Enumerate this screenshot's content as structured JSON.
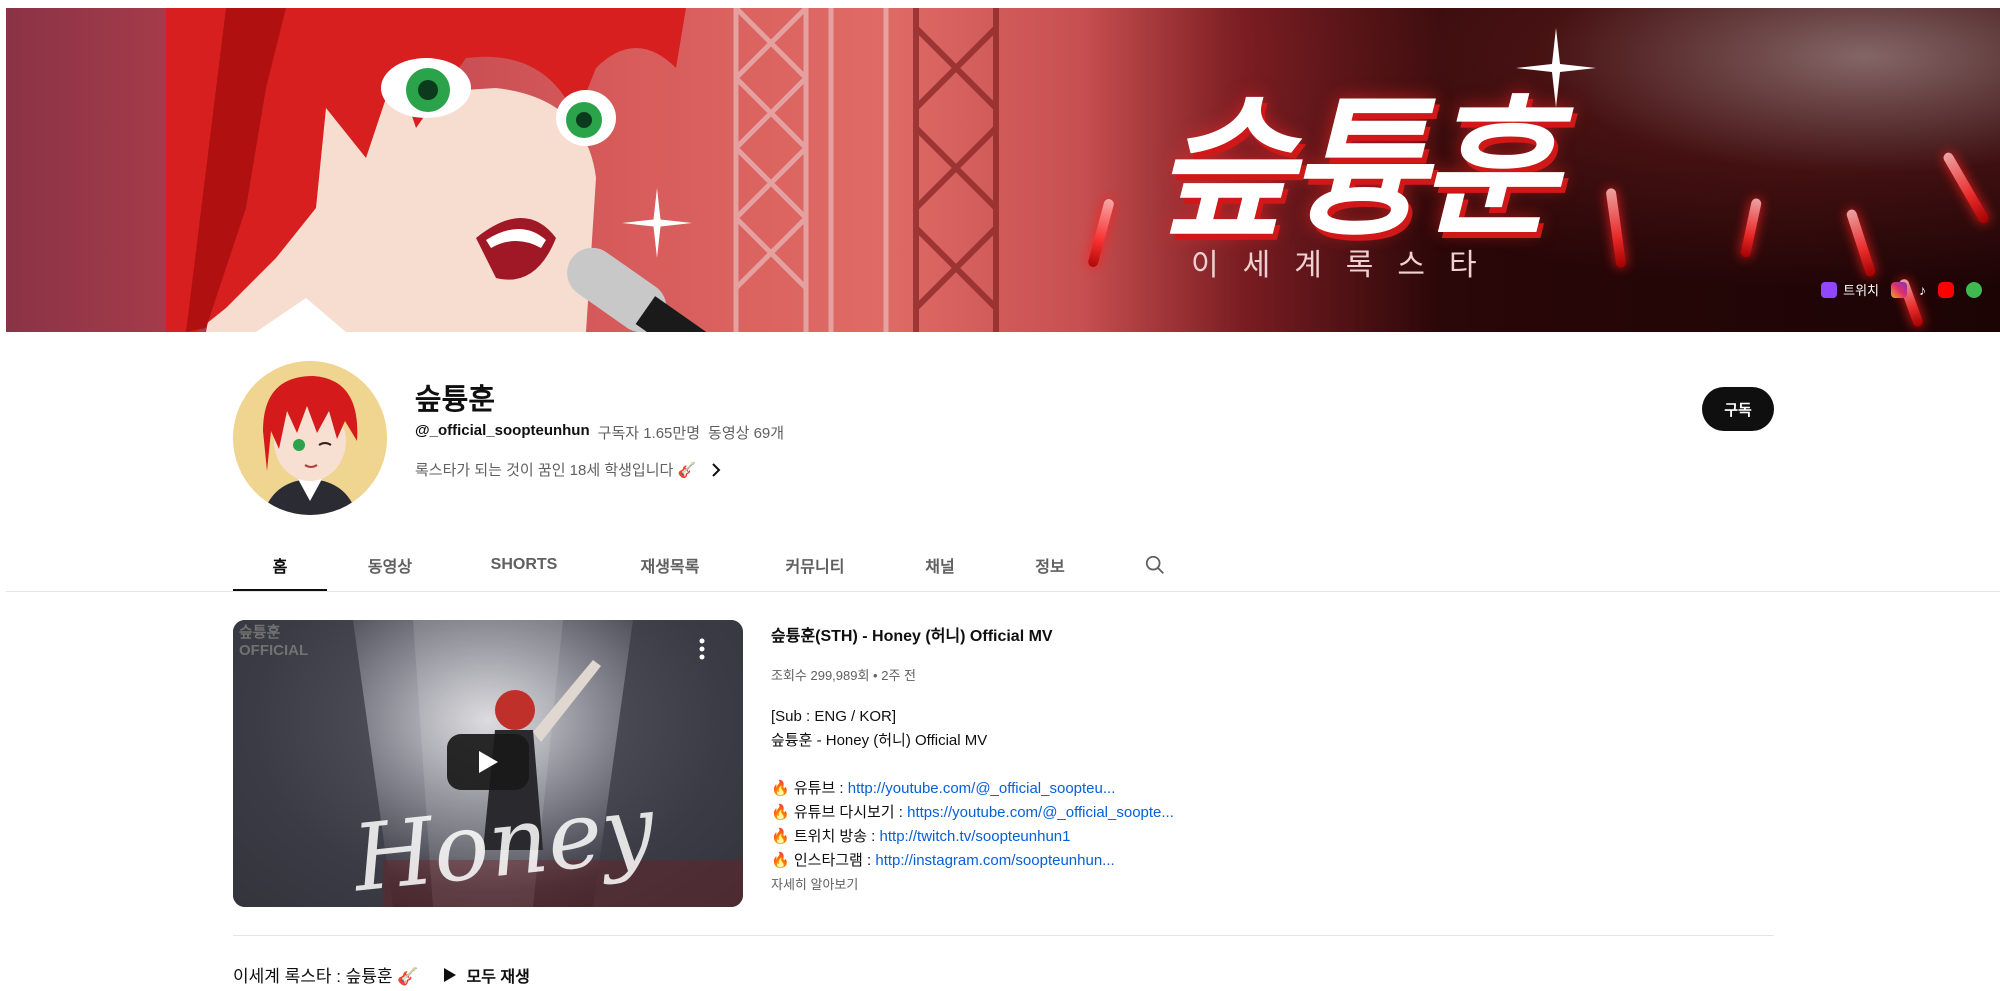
{
  "banner": {
    "logo_title": "슾튱훈",
    "logo_subtitle": "이세계록스타",
    "links": [
      {
        "icon": "twitch-icon",
        "label": "트위치",
        "color": "#9146ff"
      },
      {
        "icon": "instagram-icon",
        "label": "",
        "color": "#e1306c"
      },
      {
        "icon": "tiktok-icon",
        "label": "",
        "color": "#000000"
      },
      {
        "icon": "youtube-icon",
        "label": "",
        "color": "#ff0000"
      },
      {
        "icon": "apple-icon",
        "label": "",
        "color": "#3fb950"
      }
    ]
  },
  "channel": {
    "name": "슾튱훈",
    "handle": "@_official_soopteunhun",
    "subscribers": "구독자 1.65만명",
    "videos": "동영상 69개",
    "description": "록스타가 되는 것이 꿈인 18세 학생입니다 🎸",
    "subscribe_label": "구독"
  },
  "tabs": [
    "홈",
    "동영상",
    "SHORTS",
    "재생목록",
    "커뮤니티",
    "채널",
    "정보"
  ],
  "active_tab": 0,
  "featured": {
    "watermark": "슾튱훈\nOFFICIAL",
    "title": "슾튱훈(STH) - Honey (허니) Official MV",
    "stats": "조회수 299,989회 • 2주 전",
    "thumbnail_text": "Honey",
    "desc_lines": [
      {
        "text": "[Sub : ENG / KOR]",
        "link": ""
      },
      {
        "text": "슾튱훈 - Honey (허니) Official MV",
        "link": ""
      },
      {
        "text": "",
        "link": ""
      },
      {
        "text": "🔥 유튜브 : ",
        "link": "http://youtube.com/@_official_soopteu..."
      },
      {
        "text": "🔥 유튜브 다시보기 : ",
        "link": "https://youtube.com/@_official_soopte..."
      },
      {
        "text": "🔥 트위치 방송 : ",
        "link": "http://twitch.tv/soopteunhun1"
      },
      {
        "text": "🔥 인스타그램 : ",
        "link": "http://instagram.com/soopteunhun..."
      }
    ],
    "more_label": "자세히 알아보기"
  },
  "shelf": {
    "title": "이세계 록스타 : 슾튱훈 🎸",
    "play_all": "모두 재생"
  },
  "colors": {
    "accent": "#0f0f0f",
    "link": "#065fd4",
    "secondary_text": "#606060"
  }
}
